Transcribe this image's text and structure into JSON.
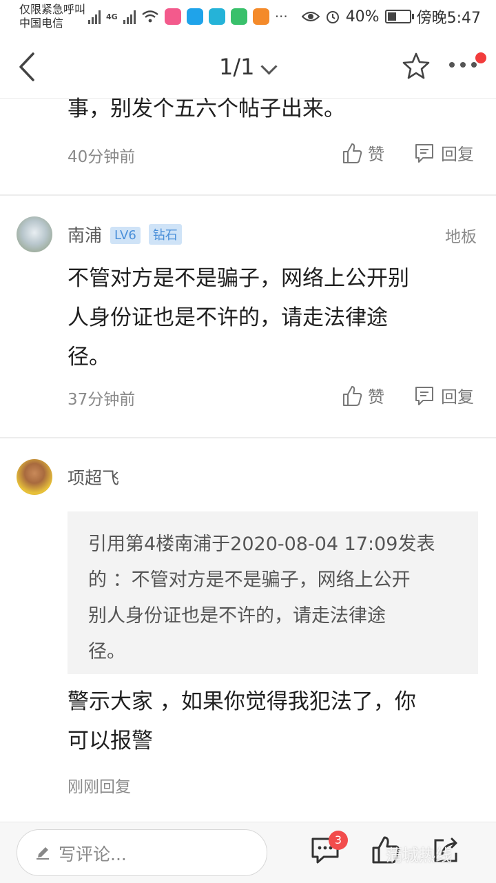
{
  "status_bar": {
    "line1": "仅限紧急呼叫",
    "carrier": "中国电信",
    "network": "4G",
    "battery": "40%",
    "time": "傍晚5:47"
  },
  "header": {
    "page_indicator": "1/1"
  },
  "comments": [
    {
      "content_tail": "事，别发个五六个帖子出来。",
      "time": "40分钟前",
      "like_label": "赞",
      "reply_label": "回复"
    },
    {
      "username": "南浦",
      "level": "LV6",
      "rank": "钻石",
      "floor": "地板",
      "content": [
        "不管对方是不是骗子，网络上公开别",
        "人身份证也是不许的，请走法律途",
        "径。"
      ],
      "time": "37分钟前",
      "like_label": "赞",
      "reply_label": "回复"
    },
    {
      "username": "项超飞",
      "quote": [
        "引用第4楼南浦于2020-08-04 17:09发表",
        "的 ：不管对方是不是骗子，网络上公开",
        "别人身份证也是不许的，请走法律途",
        "径。"
      ],
      "content": [
        "警示大家 ，如果你觉得我犯法了，你",
        "可以报警"
      ],
      "time": "刚刚回复"
    }
  ],
  "bottom_bar": {
    "comment_placeholder": "写评论...",
    "comment_count": "3",
    "watermark": "蒲城热线"
  }
}
